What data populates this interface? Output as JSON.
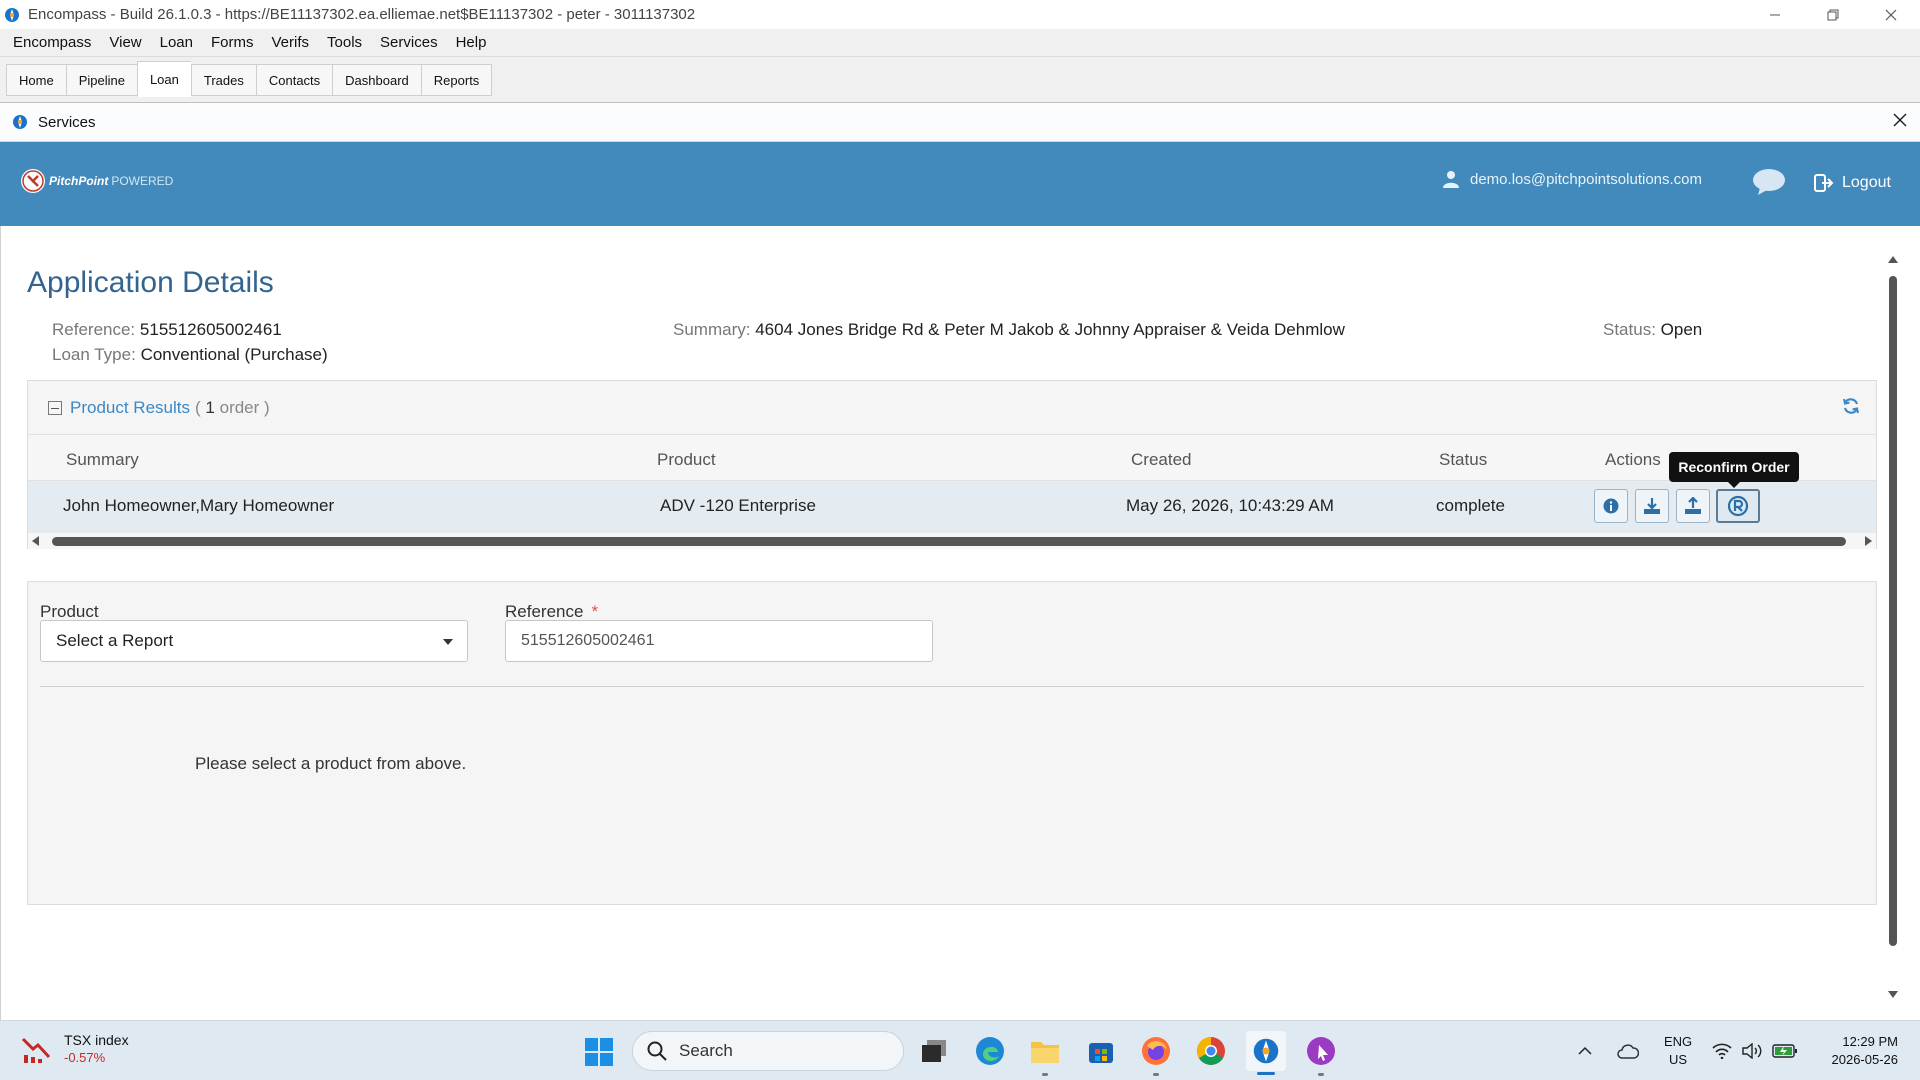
{
  "window": {
    "title": "Encompass - Build 26.1.0.3 - https://BE11137302.ea.elliemae.net$BE11137302 - peter - 3011137302"
  },
  "menu": [
    "Encompass",
    "View",
    "Loan",
    "Forms",
    "Verifs",
    "Tools",
    "Services",
    "Help"
  ],
  "tabs": [
    {
      "label": "Home",
      "active": false
    },
    {
      "label": "Pipeline",
      "active": false
    },
    {
      "label": "Loan",
      "active": true
    },
    {
      "label": "Trades",
      "active": false
    },
    {
      "label": "Contacts",
      "active": false
    },
    {
      "label": "Dashboard",
      "active": false
    },
    {
      "label": "Reports",
      "active": false
    }
  ],
  "services_panel": {
    "title": "Services"
  },
  "pp_header": {
    "logo_text": "PitchPoint",
    "logo_sub": "POWERED",
    "user_email": "demo.los@pitchpointsolutions.com",
    "logout_label": "Logout",
    "color": "#418abb"
  },
  "app": {
    "title": "Application Details",
    "reference_label": "Reference:",
    "reference_value": "515512605002461",
    "loan_type_label": "Loan Type:",
    "loan_type_value": "Conventional (Purchase)",
    "summary_label": "Summary:",
    "summary_value": "4604 Jones Bridge Rd & Peter M Jakob & Johnny Appraiser & Veida Dehmlow",
    "status_label": "Status:",
    "status_value": "Open"
  },
  "results": {
    "title": "Product Results",
    "paren_open": "(",
    "count": "1",
    "count_unit": "order )",
    "columns": [
      "Summary",
      "Product",
      "Created",
      "Status",
      "Actions"
    ],
    "rows": [
      {
        "summary": "John Homeowner,Mary Homeowner",
        "product": "ADV -120 Enterprise",
        "created": "May 26, 2026, 10:43:29 AM",
        "status": "complete"
      }
    ],
    "actions": [
      "info-icon",
      "download-icon",
      "upload-icon",
      "reconfirm-icon"
    ],
    "tooltip": "Reconfirm Order"
  },
  "form": {
    "product_label": "Product",
    "product_selected": "Select a Report",
    "reference_label": "Reference",
    "reference_required": "*",
    "reference_value": "515512605002461",
    "hint": "Please select a product from above."
  },
  "taskbar": {
    "widget_name": "TSX index",
    "widget_value": "-0.57%",
    "search_label": "Search",
    "lang_line1": "ENG",
    "lang_line2": "US",
    "time": "12:29 PM",
    "date": "2026-05-26"
  }
}
